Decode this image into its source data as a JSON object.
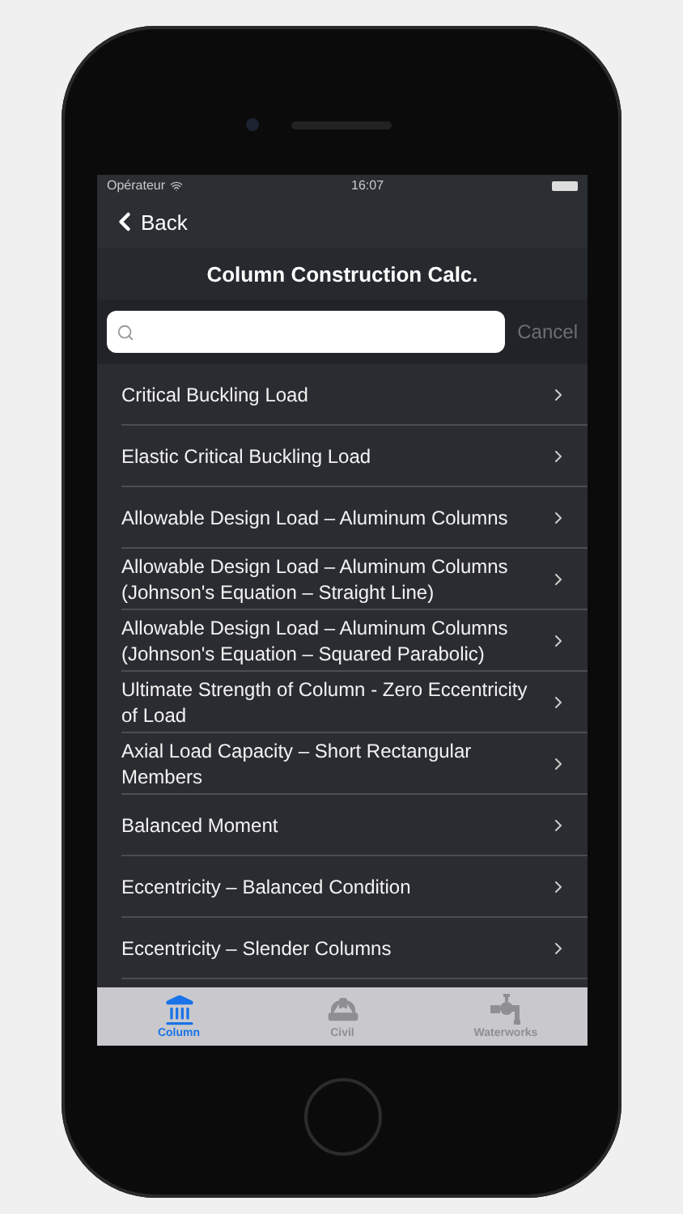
{
  "status_bar": {
    "carrier": "Opérateur",
    "time": "16:07"
  },
  "nav": {
    "back": "Back",
    "title": "Column Construction Calc."
  },
  "search": {
    "cancel": "Cancel"
  },
  "items": [
    {
      "label": "Critical Buckling Load"
    },
    {
      "label": "Elastic Critical Buckling Load"
    },
    {
      "label": "Allowable Design Load – Aluminum Columns"
    },
    {
      "label": "Allowable Design Load – Aluminum Columns (Johnson's Equation – Straight Line)"
    },
    {
      "label": "Allowable Design Load – Aluminum Columns (Johnson's Equation – Squared Parabolic)"
    },
    {
      "label": "Ultimate Strength of Column  - Zero Eccentricity of Load"
    },
    {
      "label": "Axial Load Capacity – Short Rectangular Members"
    },
    {
      "label": "Balanced Moment"
    },
    {
      "label": "Eccentricity – Balanced Condition"
    },
    {
      "label": "Eccentricity – Slender Columns"
    }
  ],
  "tabs": [
    {
      "label": "Column",
      "kind": "column",
      "selected": true
    },
    {
      "label": "Civil",
      "kind": "helmet",
      "selected": false
    },
    {
      "label": "Waterworks",
      "kind": "faucet",
      "selected": false
    }
  ]
}
